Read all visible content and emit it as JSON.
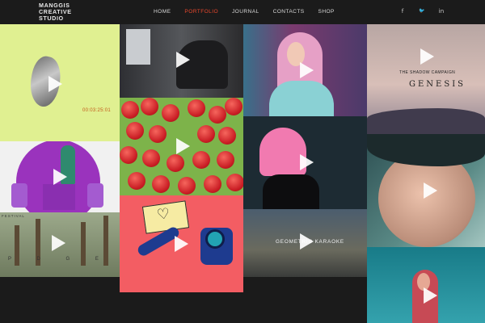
{
  "brand": {
    "line1": "MANGGIS",
    "line2": "CREATIVE",
    "line3": "STUDIO"
  },
  "nav": {
    "items": [
      {
        "label": "HOME"
      },
      {
        "label": "PORTFOLIO",
        "active": true
      },
      {
        "label": "JOURNAL"
      },
      {
        "label": "CONTACTS"
      },
      {
        "label": "SHOP"
      }
    ],
    "active_color": "#e8472c"
  },
  "social": {
    "facebook": "f",
    "twitter": "🐦",
    "linkedin": "in"
  },
  "portfolio": {
    "tiles": [
      {
        "id": "rock",
        "caption": "00:03:25:01"
      },
      {
        "id": "purple"
      },
      {
        "id": "forest",
        "laurel": "FESTIVAL",
        "letters": "P D G E"
      },
      {
        "id": "dark"
      },
      {
        "id": "raspberries"
      },
      {
        "id": "telephone"
      },
      {
        "id": "blonde"
      },
      {
        "id": "pink-hair"
      },
      {
        "id": "geometric",
        "caption": "GEOMETRIC KARAOKE"
      },
      {
        "id": "genesis",
        "caption_small": "THE SHADOW CAMPAIGN",
        "caption_large": "GENESIS"
      },
      {
        "id": "face"
      },
      {
        "id": "teal"
      }
    ]
  },
  "icons": {
    "play": "play-icon"
  },
  "colors": {
    "background": "#1b1b1b",
    "accent": "#e8472c"
  }
}
